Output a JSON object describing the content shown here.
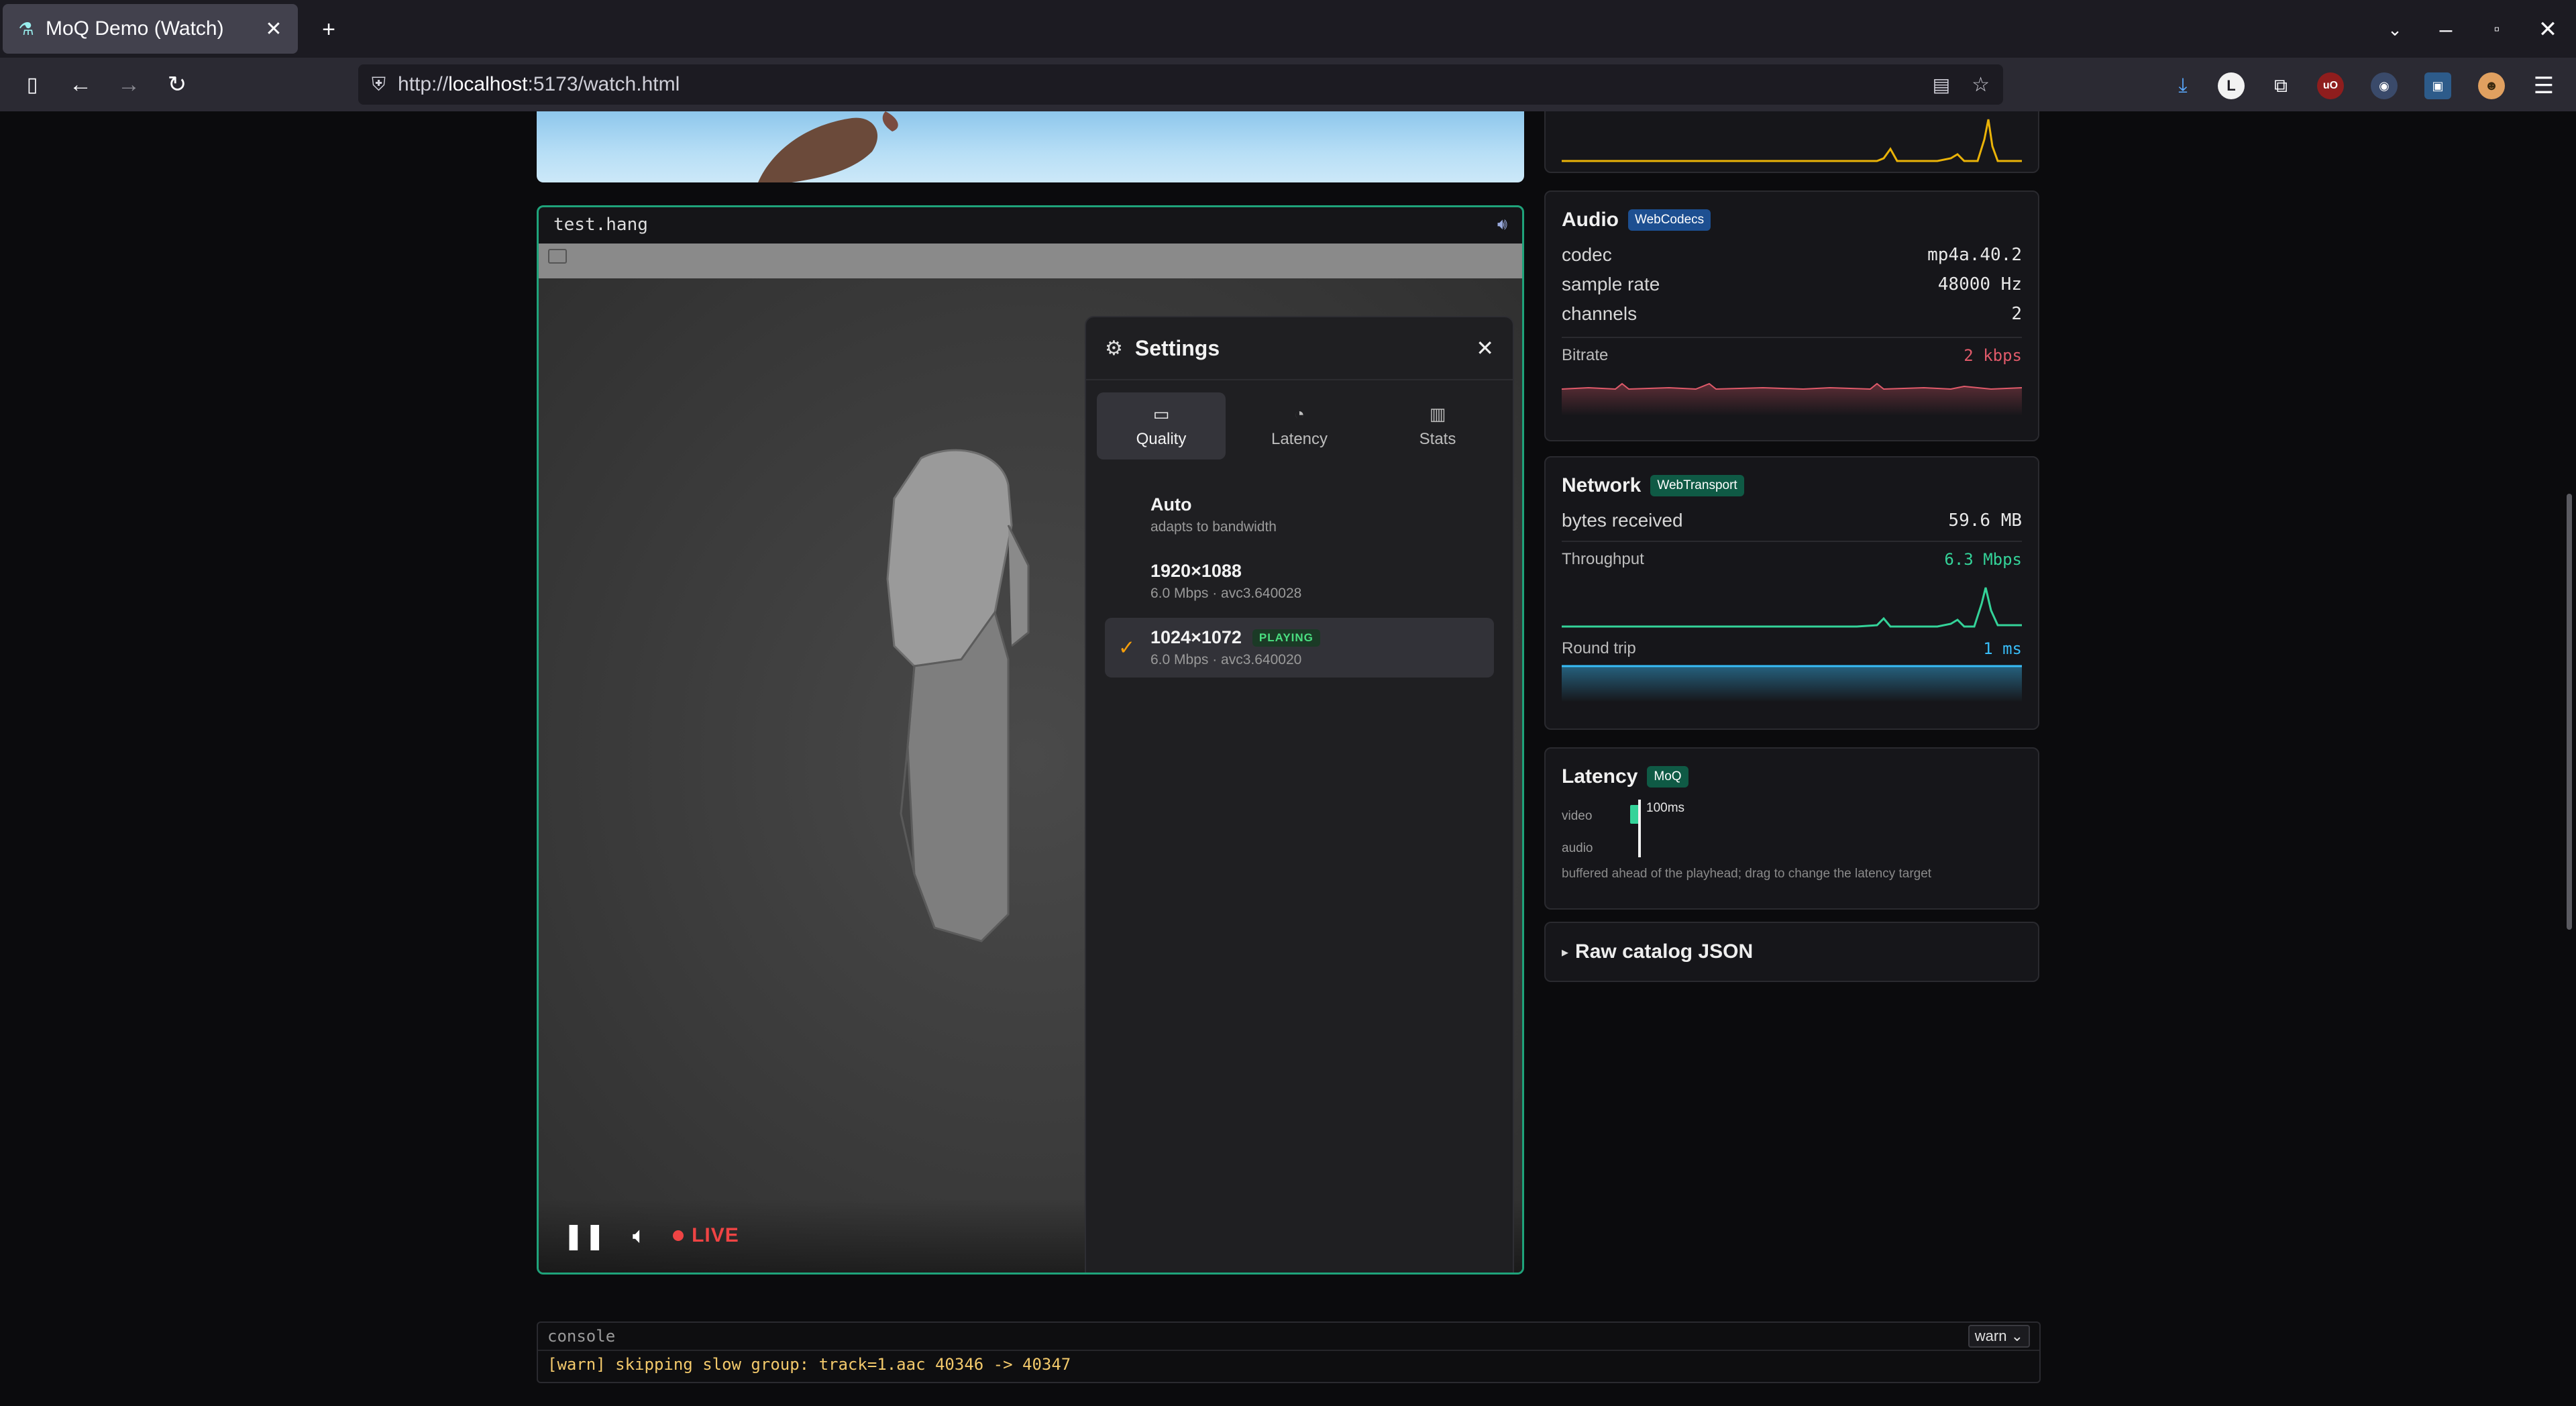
{
  "browser": {
    "tab_title": "MoQ Demo (Watch)",
    "url_prefix": "http://",
    "url_host": "localhost",
    "url_path": ":5173/watch.html"
  },
  "player": {
    "track_name": "test.hang",
    "live_label": "LIVE"
  },
  "settings": {
    "title": "Settings",
    "tabs": [
      "Quality",
      "Latency",
      "Stats"
    ],
    "options": [
      {
        "label": "Auto",
        "sub": "adapts to bandwidth"
      },
      {
        "label": "1920×1088",
        "sub": "6.0 Mbps · avc3.640028"
      },
      {
        "label": "1024×1072",
        "sub": "6.0 Mbps · avc3.640020",
        "badge": "PLAYING"
      }
    ]
  },
  "audio": {
    "title": "Audio",
    "tag": "WebCodecs",
    "codec_label": "codec",
    "codec": "mp4a.40.2",
    "rate_label": "sample rate",
    "rate": "48000 Hz",
    "channels_label": "channels",
    "channels": "2",
    "bitrate_label": "Bitrate",
    "bitrate": "2 kbps"
  },
  "network": {
    "title": "Network",
    "tag": "WebTransport",
    "bytes_label": "bytes received",
    "bytes": "59.6 MB",
    "throughput_label": "Throughput",
    "throughput": "6.3 Mbps",
    "rtt_label": "Round trip",
    "rtt": "1 ms"
  },
  "latency": {
    "title": "Latency",
    "tag": "MoQ",
    "video_label": "video",
    "audio_label": "audio",
    "target": "100ms",
    "hint": "buffered ahead of the playhead; drag to change the latency target"
  },
  "raw_catalog": {
    "label": "Raw catalog JSON"
  },
  "console": {
    "label": "console",
    "level": "warn",
    "line": "[warn] skipping slow group: track=1.aac 40346 -> 40347"
  },
  "colors": {
    "accent_green": "#1fa37a",
    "audio_graph": "#e05a6a",
    "throughput_graph": "#34d399",
    "rtt_graph": "#38bdf8",
    "video_graph": "#eab308",
    "warn_text": "#f3c96b"
  }
}
